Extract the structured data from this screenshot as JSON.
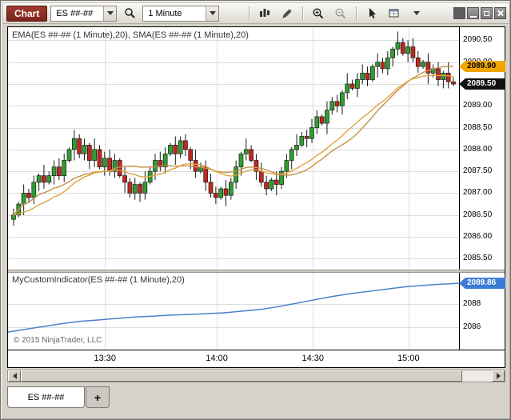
{
  "window": {
    "title_tab": "Chart"
  },
  "toolbar": {
    "instrument_value": "ES ##-##",
    "interval_value": "1 Minute",
    "icons": [
      "chevron-down-icon",
      "search-icon",
      "chart-style-icon",
      "pencil-icon",
      "zoom-in-icon",
      "zoom-out-icon",
      "cursor-icon",
      "data-box-icon",
      "minimize-icon",
      "restore-icon",
      "close-icon"
    ]
  },
  "main_panel": {
    "label": "EMA(ES ##-## (1 Minute),20), SMA(ES ##-## (1 Minute),20)"
  },
  "indicator_panel": {
    "label": "MyCustomIndicator(ES ##-## (1 Minute),20)",
    "copyright": "© 2015 NinjaTrader, LLC"
  },
  "badges": {
    "ma_value": "2089.90",
    "last_price": "2089.50",
    "indicator_value": "2089.86"
  },
  "tabs": {
    "active": "ES ##-##",
    "add": "+"
  },
  "chart_data": {
    "type": "candlestick",
    "instrument": "ES ##-##",
    "interval": "1 Minute",
    "price_ticks": [
      "2090.50",
      "2090.00",
      "2089.50",
      "2089.00",
      "2088.50",
      "2088.00",
      "2087.50",
      "2087.00",
      "2086.50",
      "2086.00",
      "2085.50"
    ],
    "indicator_ticks": [
      "2088",
      "2086"
    ],
    "time_ticks": [
      {
        "label": "13:30",
        "frac": 0.215
      },
      {
        "label": "14:00",
        "frac": 0.463
      },
      {
        "label": "14:30",
        "frac": 0.676
      },
      {
        "label": "15:00",
        "frac": 0.888
      }
    ],
    "main_range": {
      "max": 2090.8,
      "min": 2085.25
    },
    "indicator_range": {
      "max": 2090.79,
      "min": 2084.0
    },
    "open_first": 2086.4,
    "closes": [
      2086.5,
      2086.75,
      2087.0,
      2086.9,
      2087.25,
      2087.4,
      2087.25,
      2087.4,
      2087.6,
      2087.4,
      2087.75,
      2088.0,
      2088.25,
      2087.9,
      2088.1,
      2087.75,
      2088.0,
      2087.6,
      2087.8,
      2087.5,
      2087.75,
      2087.4,
      2087.25,
      2087.0,
      2087.2,
      2087.0,
      2087.25,
      2087.5,
      2087.75,
      2087.6,
      2087.9,
      2088.1,
      2087.9,
      2088.2,
      2088.0,
      2087.75,
      2087.5,
      2087.6,
      2087.25,
      2087.0,
      2086.9,
      2087.1,
      2086.95,
      2087.25,
      2087.6,
      2087.9,
      2088.0,
      2087.75,
      2087.5,
      2087.25,
      2087.1,
      2087.3,
      2087.2,
      2087.5,
      2087.75,
      2088.0,
      2088.1,
      2088.3,
      2088.25,
      2088.5,
      2088.75,
      2088.6,
      2088.9,
      2089.1,
      2089.0,
      2089.3,
      2089.5,
      2089.4,
      2089.6,
      2089.75,
      2089.6,
      2089.9,
      2090.0,
      2089.85,
      2090.1,
      2090.3,
      2090.45,
      2090.2,
      2090.35,
      2090.1,
      2089.9,
      2090.0,
      2089.75,
      2089.85,
      2089.6,
      2089.75,
      2089.55,
      2089.5
    ],
    "wick_pattern": [
      0.15,
      0.05,
      0.2,
      0.1,
      0.15,
      0.05,
      0.25,
      0.1,
      0.15,
      0.2
    ],
    "ema_period": 20,
    "sma_period": 20,
    "indicator_points": [
      {
        "frac": 0.0,
        "value": 2085.55
      },
      {
        "frac": 0.04,
        "value": 2085.8
      },
      {
        "frac": 0.08,
        "value": 2086.05
      },
      {
        "frac": 0.12,
        "value": 2086.3
      },
      {
        "frac": 0.16,
        "value": 2086.5
      },
      {
        "frac": 0.2,
        "value": 2086.62
      },
      {
        "frac": 0.24,
        "value": 2086.75
      },
      {
        "frac": 0.28,
        "value": 2086.88
      },
      {
        "frac": 0.32,
        "value": 2086.95
      },
      {
        "frac": 0.36,
        "value": 2087.05
      },
      {
        "frac": 0.4,
        "value": 2087.1
      },
      {
        "frac": 0.44,
        "value": 2087.18
      },
      {
        "frac": 0.48,
        "value": 2087.25
      },
      {
        "frac": 0.52,
        "value": 2087.4
      },
      {
        "frac": 0.56,
        "value": 2087.55
      },
      {
        "frac": 0.6,
        "value": 2087.8
      },
      {
        "frac": 0.64,
        "value": 2088.1
      },
      {
        "frac": 0.68,
        "value": 2088.4
      },
      {
        "frac": 0.72,
        "value": 2088.7
      },
      {
        "frac": 0.76,
        "value": 2088.95
      },
      {
        "frac": 0.8,
        "value": 2089.15
      },
      {
        "frac": 0.84,
        "value": 2089.35
      },
      {
        "frac": 0.88,
        "value": 2089.55
      },
      {
        "frac": 0.92,
        "value": 2089.68
      },
      {
        "frac": 0.96,
        "value": 2089.78
      },
      {
        "frac": 1.0,
        "value": 2089.86
      }
    ],
    "colors": {
      "up": "#2E9E2E",
      "down": "#C1271E",
      "wick": "#1a1a1a",
      "ema": "#E2A33C",
      "sma": "#C89048",
      "indicator": "#4A82C8",
      "grid": "#DCDCDC",
      "badge_ma": "#F0A500",
      "badge_last": "#111111",
      "badge_indicator": "#3A7BD5"
    }
  }
}
